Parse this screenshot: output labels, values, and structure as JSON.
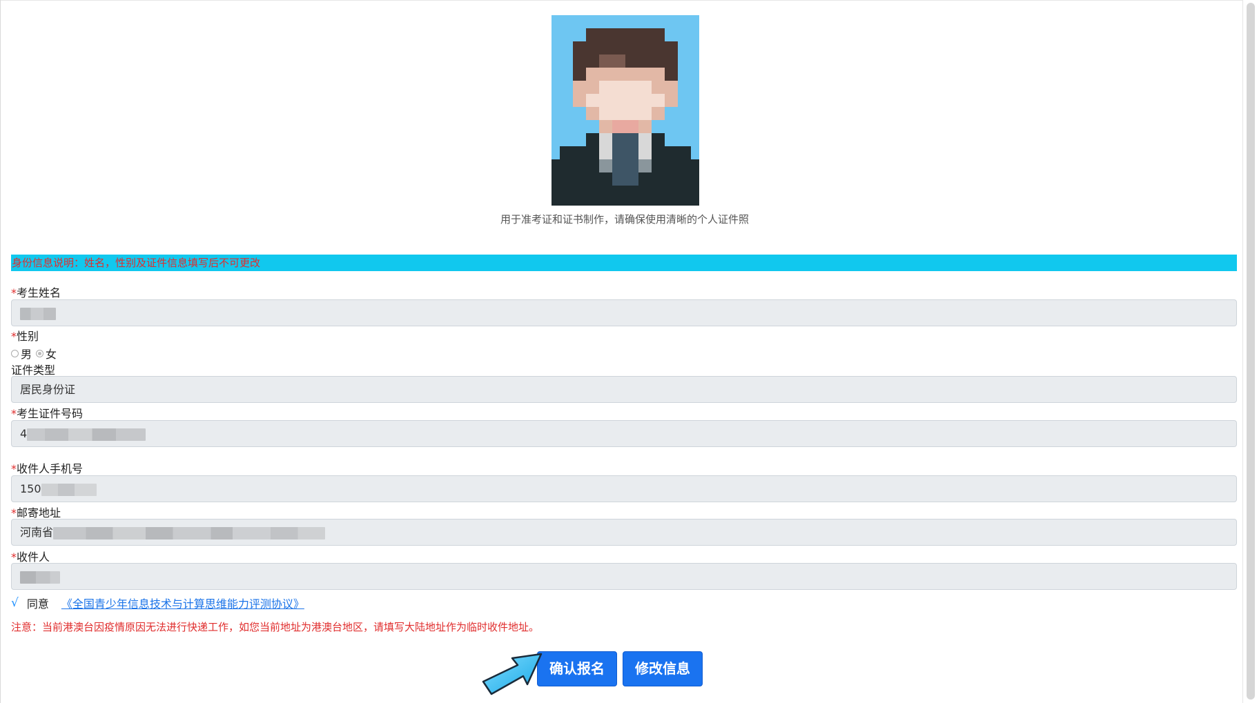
{
  "photo": {
    "caption": "用于准考证和证书制作，请确保使用清晰的个人证件照"
  },
  "notice": {
    "text": "身份信息说明：姓名，性别及证件信息填写后不可更改"
  },
  "form": {
    "required_mark": "*",
    "name": {
      "label": "考生姓名",
      "value": ""
    },
    "gender": {
      "label": "性别",
      "options": [
        "男",
        "女"
      ],
      "selected": "女"
    },
    "id_type": {
      "label": "证件类型",
      "value": "居民身份证"
    },
    "id_number": {
      "label": "考生证件号码",
      "value_prefix": "4"
    },
    "phone": {
      "label": "收件人手机号",
      "value_prefix": "150"
    },
    "address": {
      "label": "邮寄地址",
      "value_prefix": "河南省"
    },
    "recipient": {
      "label": "收件人",
      "value": ""
    }
  },
  "agreement": {
    "check_glyph": "√",
    "agree_text": "同意",
    "link_text": "《全国青少年信息技术与计算思维能力评测协议》",
    "checked": true
  },
  "warning": {
    "text": "注意：当前港澳台因疫情原因无法进行快递工作，如您当前地址为港澳台地区，请填写大陆地址作为临时收件地址。"
  },
  "buttons": {
    "confirm": "确认报名",
    "modify": "修改信息"
  },
  "colors": {
    "notice_bg": "#11c8ee",
    "notice_text": "#e02d2d",
    "button_bg": "#1a73f0",
    "field_bg": "#e9ecef",
    "link": "#1a73e8"
  }
}
